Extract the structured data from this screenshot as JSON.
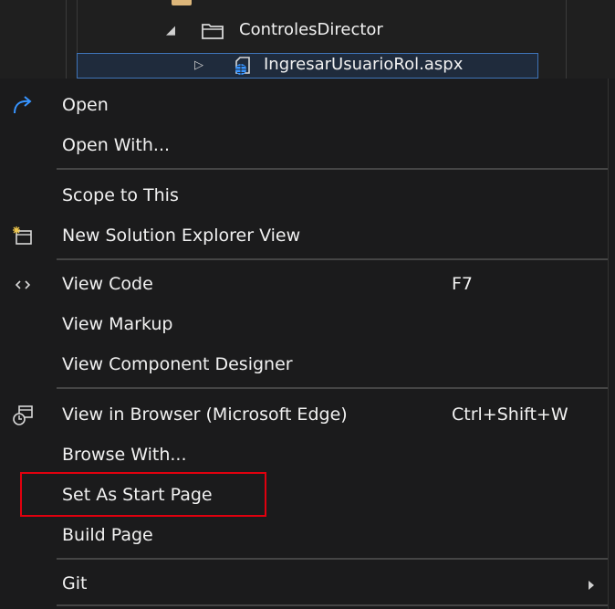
{
  "tree": {
    "folder_label": "ControlesDirector",
    "file_label": "IngresarUsuarioRol.aspx"
  },
  "menu": {
    "open": "Open",
    "open_with": "Open With...",
    "scope_to_this": "Scope to This",
    "new_solution_explorer_view": "New Solution Explorer View",
    "view_code": "View Code",
    "view_code_shortcut": "F7",
    "view_markup": "View Markup",
    "view_component_designer": "View Component Designer",
    "view_in_browser": "View in Browser (Microsoft Edge)",
    "view_in_browser_shortcut": "Ctrl+Shift+W",
    "browse_with": "Browse With...",
    "set_as_start_page": "Set As Start Page",
    "build_page": "Build Page",
    "git": "Git"
  },
  "colors": {
    "background": "#1b1b1c",
    "selection_border": "#3f74b8",
    "highlight_border": "#e0000e",
    "icon_blue": "#3794ff"
  }
}
